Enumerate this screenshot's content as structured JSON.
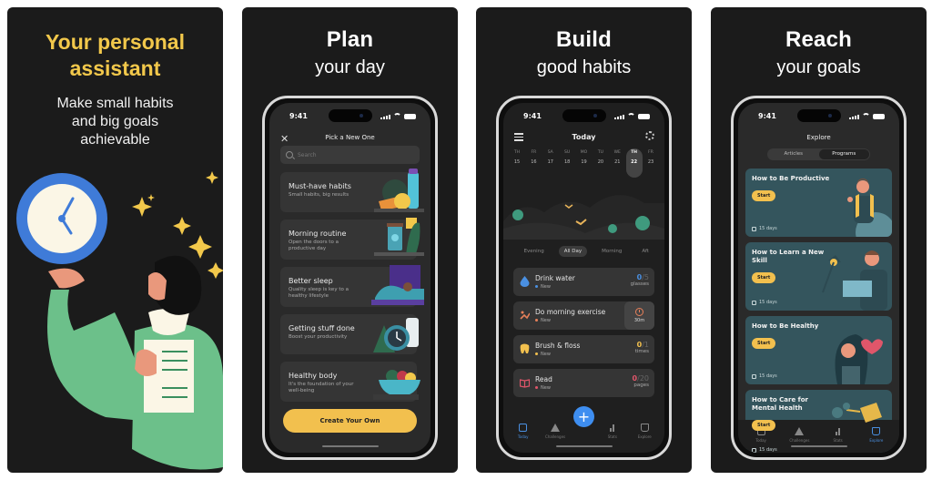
{
  "panels": [
    {
      "headline": "Your personal assistant",
      "subline": "Make small habits and big goals achievable"
    },
    {
      "headline": "Plan",
      "subline": "your day",
      "screen": {
        "time": "9:41",
        "title": "Pick a New One",
        "search_placeholder": "Search",
        "categories": [
          {
            "title": "Must-have habits",
            "subtitle": "Small habits, big results"
          },
          {
            "title": "Morning routine",
            "subtitle": "Open the doors to a productive day"
          },
          {
            "title": "Better sleep",
            "subtitle": "Quality sleep is key to a healthy lifestyle"
          },
          {
            "title": "Getting stuff done",
            "subtitle": "Boost your productivity"
          },
          {
            "title": "Healthy body",
            "subtitle": "It's the foundation of your well-being"
          }
        ],
        "create_label": "Create Your Own"
      }
    },
    {
      "headline": "Build",
      "subline": "good habits",
      "screen": {
        "time": "9:41",
        "title": "Today",
        "week": [
          {
            "dow": "TH",
            "date": "15"
          },
          {
            "dow": "FR",
            "date": "16"
          },
          {
            "dow": "SA",
            "date": "17"
          },
          {
            "dow": "SU",
            "date": "18"
          },
          {
            "dow": "MO",
            "date": "19"
          },
          {
            "dow": "TU",
            "date": "20"
          },
          {
            "dow": "WE",
            "date": "21"
          },
          {
            "dow": "TH",
            "date": "22",
            "active": true
          },
          {
            "dow": "FR",
            "date": "23"
          }
        ],
        "periods": [
          "Evening",
          "All Day",
          "Morning",
          "Afternoon"
        ],
        "active_period": "All Day",
        "habits": [
          {
            "name": "Drink water",
            "badge": "New",
            "done": "0",
            "total": "/5",
            "unit": "glasses",
            "color": "#4a90e2"
          },
          {
            "name": "Do morning exercise",
            "badge": "New",
            "timer": "30m",
            "color": "#e8805a"
          },
          {
            "name": "Brush & floss",
            "badge": "New",
            "done": "0",
            "total": "/1",
            "unit": "times",
            "color": "#f2c04e"
          },
          {
            "name": "Read",
            "badge": "New",
            "done": "0",
            "total": "/20",
            "unit": "pages",
            "color": "#e0566a"
          }
        ],
        "tabs": [
          {
            "label": "Today",
            "active": true
          },
          {
            "label": "Challenges"
          },
          {
            "label": "Stats"
          },
          {
            "label": "Explore"
          }
        ],
        "fab_label": "+"
      }
    },
    {
      "headline": "Reach",
      "subline": "your goals",
      "screen": {
        "time": "9:41",
        "title": "Explore",
        "segments": [
          "Articles",
          "Programs"
        ],
        "active_segment": "Programs",
        "programs": [
          {
            "title": "How to Be Productive",
            "start": "Start",
            "duration": "15 days"
          },
          {
            "title": "How to Learn a New Skill",
            "start": "Start",
            "duration": "15 days"
          },
          {
            "title": "How to Be Healthy",
            "start": "Start",
            "duration": "15 days"
          },
          {
            "title": "How to Care for Mental Health",
            "start": "Start",
            "duration": "15 days"
          }
        ],
        "tabs": [
          {
            "label": "Today"
          },
          {
            "label": "Challenges"
          },
          {
            "label": "Stats"
          },
          {
            "label": "Explore",
            "active": true
          }
        ]
      }
    }
  ],
  "colors": {
    "accent_yellow": "#f2c04e",
    "accent_blue": "#3e8ef0",
    "panel_bg": "#1b1b1b",
    "program_card": "#34555d"
  }
}
